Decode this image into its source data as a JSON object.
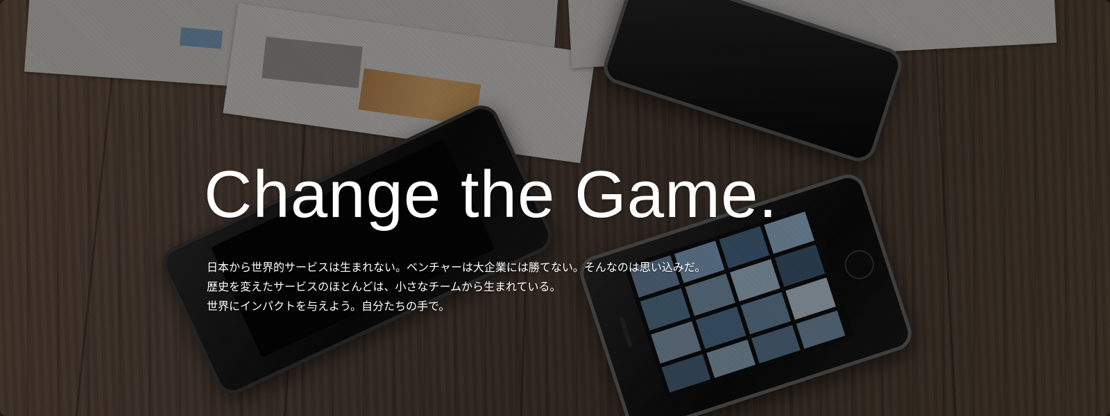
{
  "hero": {
    "headline": "Change the Game.",
    "lines": [
      "日本から世界的サービスは生まれない。ベンチャーは大企業には勝てない。そんなのは思い込みだ。",
      "歴史を変えたサービスのほとんどは、小さなチームから生まれている。",
      "世界にインパクトを与えよう。自分たちの手で。"
    ]
  },
  "colors": {
    "headline_text": "#ffffff",
    "body_text": "#ffffff",
    "wood": "#55443a"
  }
}
